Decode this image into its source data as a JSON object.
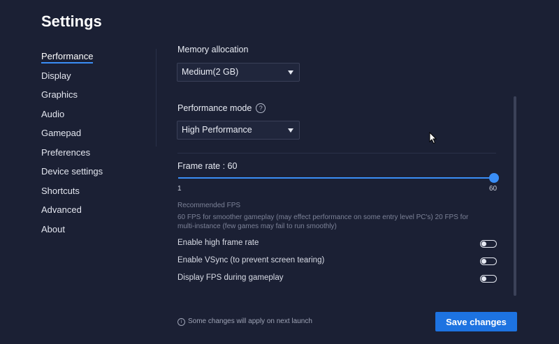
{
  "title": "Settings",
  "sidebar": {
    "items": [
      {
        "label": "Performance",
        "active": true
      },
      {
        "label": "Display"
      },
      {
        "label": "Graphics"
      },
      {
        "label": "Audio"
      },
      {
        "label": "Gamepad"
      },
      {
        "label": "Preferences"
      },
      {
        "label": "Device settings"
      },
      {
        "label": "Shortcuts"
      },
      {
        "label": "Advanced"
      },
      {
        "label": "About"
      }
    ]
  },
  "performance": {
    "memory_label": "Memory allocation",
    "memory_value": "Medium(2 GB)",
    "mode_label": "Performance mode",
    "mode_help": "?",
    "mode_value": "High Performance",
    "frame_rate_label": "Frame rate : 60",
    "frame_rate": {
      "value": 60,
      "min": 1,
      "max": 60,
      "min_label": "1",
      "max_label": "60"
    },
    "recommended_title": "Recommended FPS",
    "recommended_text": "60 FPS for smoother gameplay (may effect performance on some entry level PC's) 20 FPS for multi-instance (few games may fail to run smoothly)",
    "toggles": [
      {
        "label": "Enable high frame rate",
        "on": false
      },
      {
        "label": "Enable VSync (to prevent screen tearing)",
        "on": false
      },
      {
        "label": "Display FPS during gameplay",
        "on": false
      }
    ]
  },
  "footer": {
    "info_icon": "i",
    "note": "Some changes will apply on next launch",
    "save_label": "Save changes"
  },
  "colors": {
    "accent": "#3a8ef6",
    "button": "#1d73e1",
    "background": "#1b2034"
  }
}
